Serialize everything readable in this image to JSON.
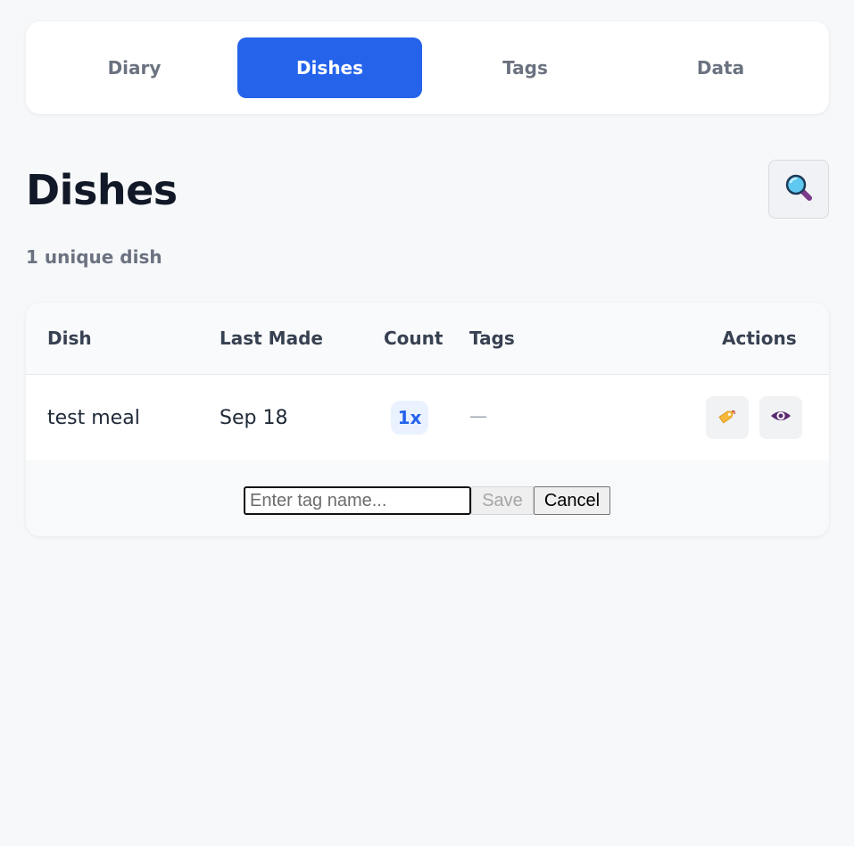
{
  "nav": {
    "tabs": [
      {
        "label": "Diary",
        "active": false
      },
      {
        "label": "Dishes",
        "active": true
      },
      {
        "label": "Tags",
        "active": false
      },
      {
        "label": "Data",
        "active": false
      }
    ]
  },
  "page": {
    "title": "Dishes",
    "subtitle": "1 unique dish",
    "search_icon": "magnifying-glass-icon"
  },
  "table": {
    "headers": {
      "dish": "Dish",
      "last_made": "Last Made",
      "count": "Count",
      "tags": "Tags",
      "actions": "Actions"
    },
    "rows": [
      {
        "dish": "test meal",
        "last_made": "Sep 18",
        "count": "1x",
        "tags": "—",
        "actions": [
          "tag-icon",
          "eye-icon"
        ]
      }
    ]
  },
  "tag_editor": {
    "placeholder": "Enter tag name...",
    "value": "",
    "save_label": "Save",
    "cancel_label": "Cancel"
  },
  "colors": {
    "accent": "#2563eb",
    "background": "#f7f8fa",
    "badge_bg": "#eaf2ff"
  }
}
